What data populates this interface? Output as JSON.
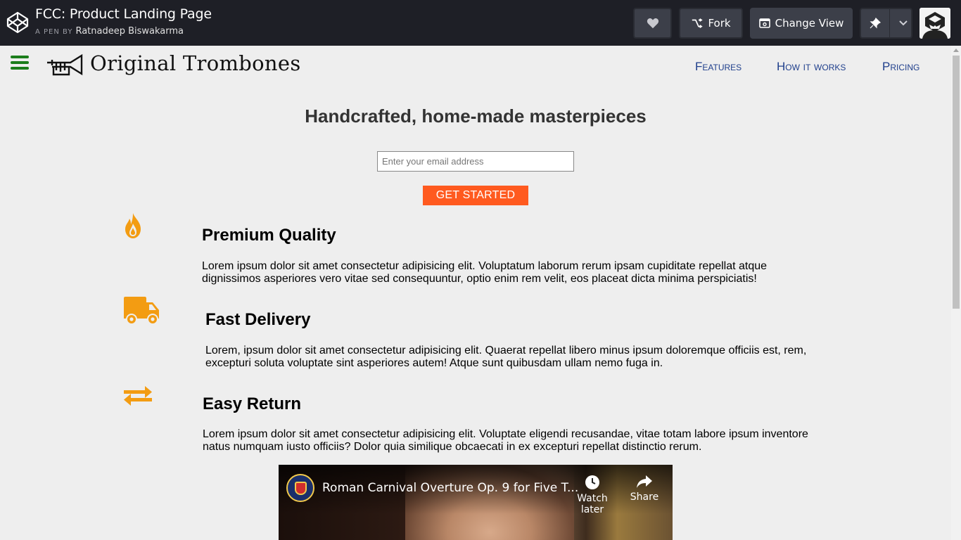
{
  "codepen": {
    "title": "FCC: Product Landing Page",
    "byline_prefix": "A PEN BY",
    "author": "Ratnadeep Biswakarma",
    "fork_label": "Fork",
    "change_view_label": "Change View"
  },
  "page": {
    "brand_name": "Original Trombones",
    "nav": [
      "Features",
      "How it works",
      "Pricing"
    ],
    "hero": {
      "title": "Handcrafted, home-made masterpieces",
      "email_placeholder": "Enter your email address",
      "cta_label": "GET STARTED"
    },
    "features": [
      {
        "icon": "fire-icon",
        "title": "Premium Quality",
        "text": "Lorem ipsum dolor sit amet consectetur adipisicing elit. Voluptatum laborum rerum ipsam cupiditate repellat atque dignissimos asperiores vero vitae sed consequuntur, optio enim rem velit, eos placeat dicta minima perspiciatis!"
      },
      {
        "icon": "truck-icon",
        "title": "Fast Delivery",
        "text": "Lorem, ipsum dolor sit amet consectetur adipisicing elit. Quaerat repellat libero minus ipsum doloremque officiis est, rem, excepturi soluta voluptate sint asperiores autem! Atque sunt quibusdam ullam nemo fuga in."
      },
      {
        "icon": "exchange-icon",
        "title": "Easy Return",
        "text": "Lorem ipsum dolor sit amet consectetur adipisicing elit. Voluptate eligendi recusandae, vitae totam labore ipsum inventore natus numquam iusto officiis? Dolor quia similique obcaecati in ex excepturi repellat distinctio rerum."
      }
    ],
    "video": {
      "title": "Roman Carnival Overture Op. 9 for Five T...",
      "watch_later": "Watch later",
      "share": "Share"
    }
  },
  "colors": {
    "codepen_bar": "#1e1f26",
    "nav_link": "#1f3f8c",
    "cta": "#ff5a1f",
    "icon_orange": "#f39c12",
    "hamburger": "#1b7d1b"
  }
}
